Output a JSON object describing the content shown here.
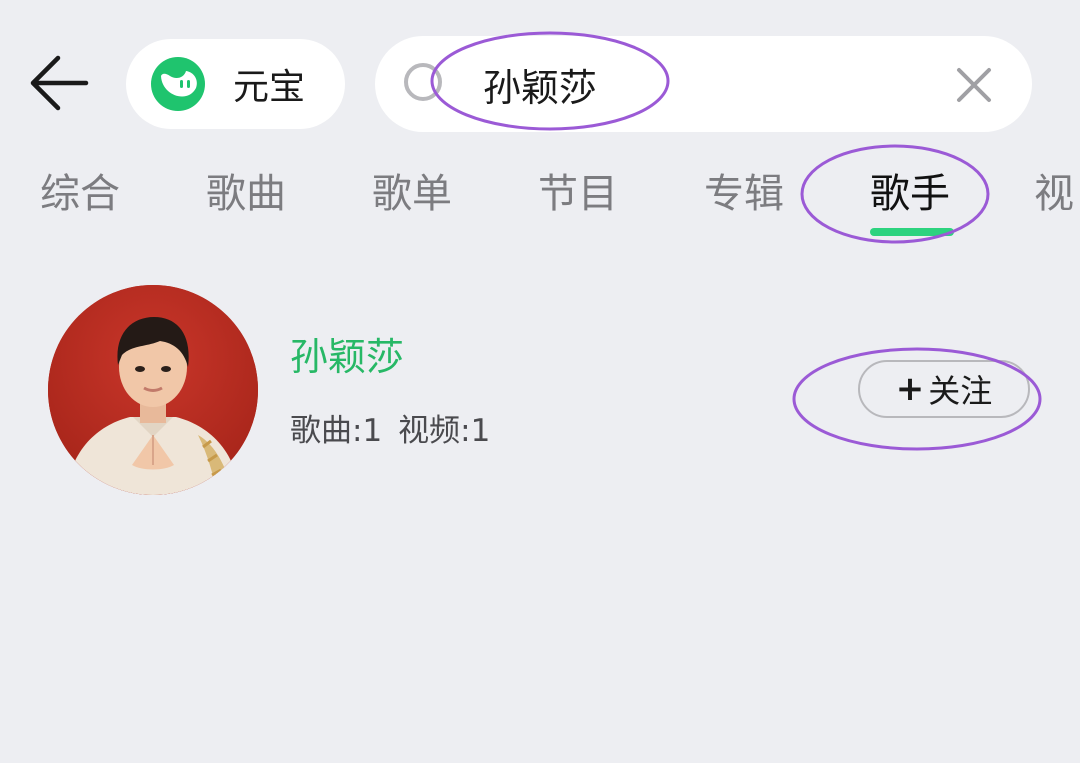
{
  "header": {
    "back_icon": "arrow-left-icon",
    "app_chip": {
      "label": "元宝",
      "logo_icon": "yuanbao-logo-icon",
      "logo_color": "#1fc46e"
    },
    "search": {
      "value": "孙颖莎",
      "search_icon": "search-icon",
      "clear_icon": "close-icon"
    }
  },
  "tabs": [
    {
      "label": "综合",
      "active": false
    },
    {
      "label": "歌曲",
      "active": false
    },
    {
      "label": "歌单",
      "active": false
    },
    {
      "label": "节目",
      "active": false
    },
    {
      "label": "专辑",
      "active": false
    },
    {
      "label": "歌手",
      "active": true
    },
    {
      "label": "视",
      "active": false
    }
  ],
  "results": [
    {
      "name": "孙颖莎",
      "songs": "歌曲:1",
      "videos": "视频:1",
      "follow_label": "关注",
      "follow_icon": "plus-icon"
    }
  ],
  "colors": {
    "background": "#edeef2",
    "accent_green": "#2dd37f",
    "name_green": "#27b866",
    "annotation_purple": "#9b5ad6"
  }
}
